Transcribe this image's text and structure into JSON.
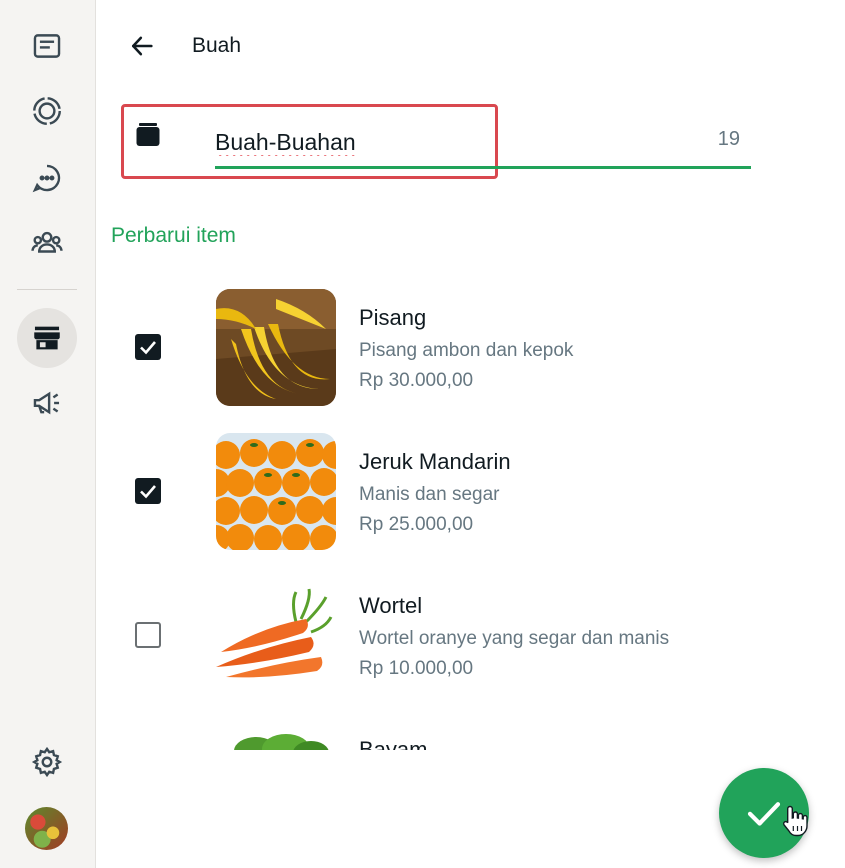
{
  "header": {
    "title": "Buah"
  },
  "collection_field": {
    "value": "Buah-Buahan",
    "char_count": "19"
  },
  "section": {
    "title": "Perbarui item"
  },
  "items": [
    {
      "name": "Pisang",
      "description": "Pisang ambon dan kepok",
      "price": "Rp 30.000,00",
      "checked": true
    },
    {
      "name": "Jeruk Mandarin",
      "description": "Manis dan segar",
      "price": "Rp 25.000,00",
      "checked": true
    },
    {
      "name": "Wortel",
      "description": "Wortel oranye yang segar dan manis",
      "price": "Rp 10.000,00",
      "checked": false
    },
    {
      "name": "Bayam",
      "description": "",
      "price": "",
      "checked": false
    }
  ],
  "rail": {
    "items": [
      {
        "icon": "chats-icon"
      },
      {
        "icon": "status-icon"
      },
      {
        "icon": "channels-icon"
      },
      {
        "icon": "communities-icon"
      },
      {
        "icon": "business-store-icon",
        "active": true
      },
      {
        "icon": "megaphone-icon"
      }
    ],
    "bottom": [
      {
        "icon": "settings-icon"
      },
      {
        "icon": "profile-avatar"
      }
    ]
  },
  "colors": {
    "accent": "#21a35a",
    "highlight_border": "#d9484f",
    "text_primary": "#111b21",
    "text_secondary": "#667781"
  }
}
